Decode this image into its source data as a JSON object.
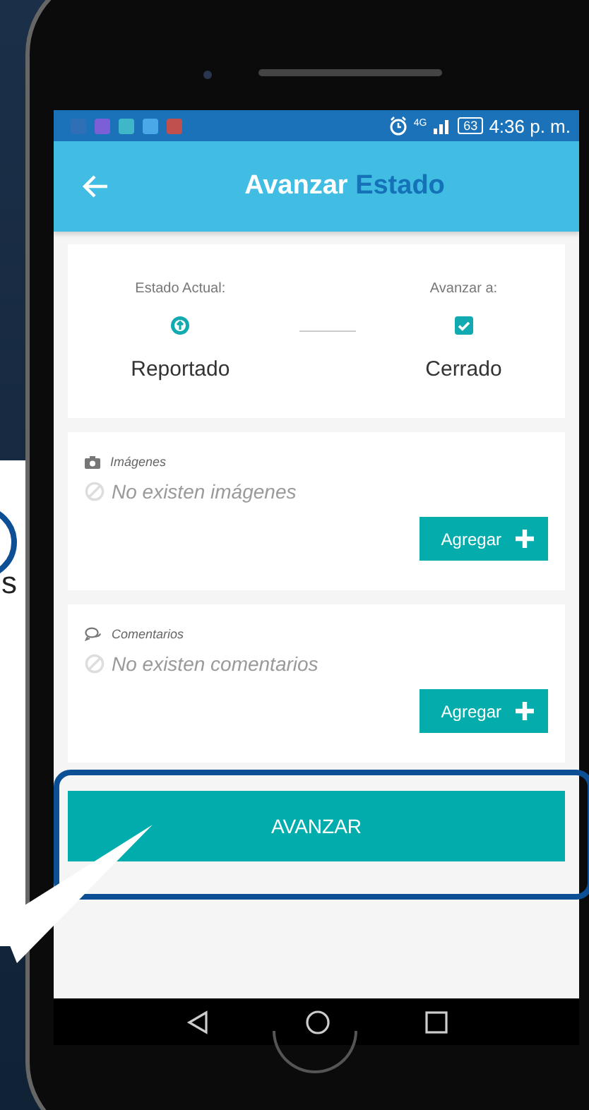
{
  "status_bar": {
    "network": "4G",
    "battery": "63",
    "time": "4:36 p. m."
  },
  "app_bar": {
    "title": "Avanzar",
    "title_accent": "Estado"
  },
  "status_card": {
    "current": {
      "label": "Estado Actual:",
      "value": "Reportado"
    },
    "next": {
      "label": "Avanzar a:",
      "value": "Cerrado",
      "checked": true
    }
  },
  "sections": [
    {
      "kind": "images",
      "title": "Imágenes",
      "empty_text": "No existen imágenes",
      "button": "Agregar"
    },
    {
      "kind": "comments",
      "title": "Comentarios",
      "empty_text": "No existen comentarios",
      "button": "Agregar"
    }
  ],
  "primary_button": "AVANZAR",
  "callout": {
    "text": "s"
  }
}
